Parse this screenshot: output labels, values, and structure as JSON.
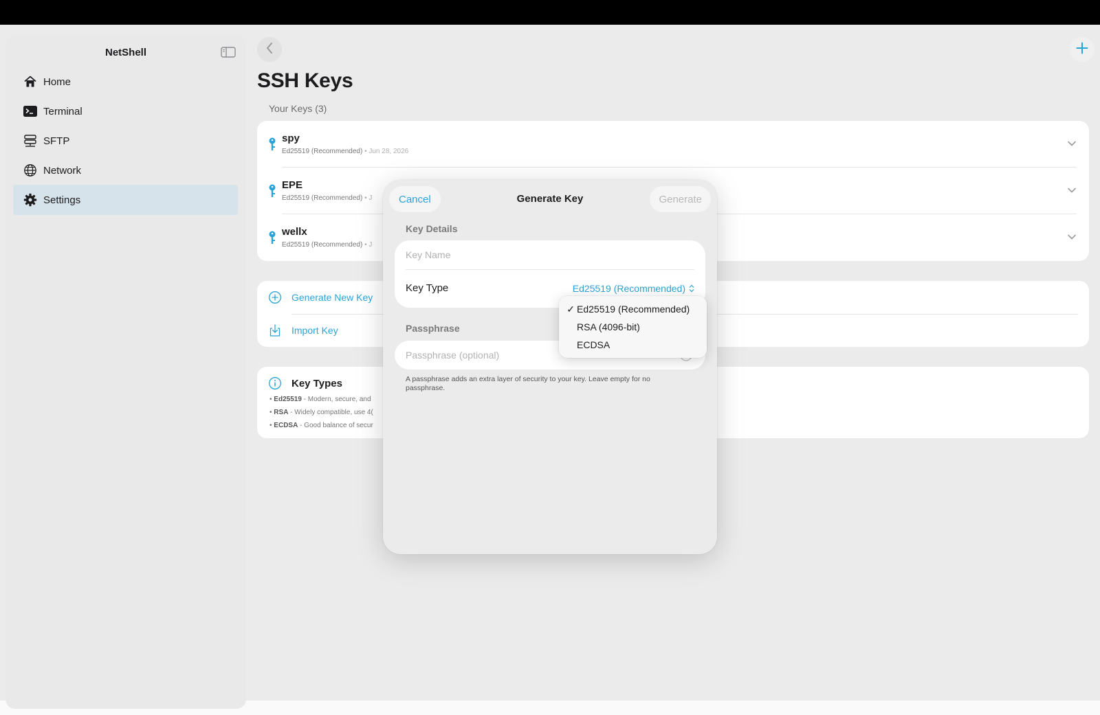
{
  "sidebar": {
    "app_title": "NetShell",
    "items": [
      {
        "label": "Home",
        "icon": "home-icon"
      },
      {
        "label": "Terminal",
        "icon": "terminal-icon"
      },
      {
        "label": "SFTP",
        "icon": "server-icon"
      },
      {
        "label": "Network",
        "icon": "globe-icon"
      },
      {
        "label": "Settings",
        "icon": "gear-icon",
        "active": true
      }
    ]
  },
  "main": {
    "title": "SSH Keys",
    "section_header": "Your Keys (3)",
    "keys": [
      {
        "name": "spy",
        "type": "Ed25519 (Recommended)",
        "date": "Jun 28, 2026"
      },
      {
        "name": "EPE",
        "type": "Ed25519 (Recommended)",
        "date": "J"
      },
      {
        "name": "wellx",
        "type": "Ed25519 (Recommended)",
        "date": "J"
      }
    ],
    "meta_separator": "•",
    "actions": {
      "generate_label": "Generate New Key",
      "import_label": "Import Key"
    },
    "key_types": {
      "title": "Key Types",
      "lines": [
        {
          "bullet": "•",
          "name": "Ed25519",
          "text": "- Modern, secure, and"
        },
        {
          "bullet": "•",
          "name": "RSA",
          "text": "- Widely compatible, use 4("
        },
        {
          "bullet": "•",
          "name": "ECDSA",
          "text": "- Good balance of secur"
        }
      ]
    }
  },
  "modal": {
    "title": "Generate Key",
    "cancel_label": "Cancel",
    "generate_label": "Generate",
    "key_details_header": "Key Details",
    "key_name_placeholder": "Key Name",
    "key_type_label": "Key Type",
    "key_type_value": "Ed25519 (Recommended)",
    "passphrase_header": "Passphrase",
    "passphrase_placeholder": "Passphrase (optional)",
    "passphrase_hint": "A passphrase adds an extra layer of security to your key. Leave empty for no passphrase."
  },
  "dropdown": {
    "check_mark": "✓",
    "options": [
      {
        "label": "Ed25519 (Recommended)",
        "selected": true
      },
      {
        "label": "RSA (4096-bit)",
        "selected": false
      },
      {
        "label": "ECDSA",
        "selected": false
      }
    ]
  },
  "colors": {
    "accent": "#2aa3d6",
    "selected_sidebar": "#d6e3ea",
    "background": "#ebebeb"
  }
}
